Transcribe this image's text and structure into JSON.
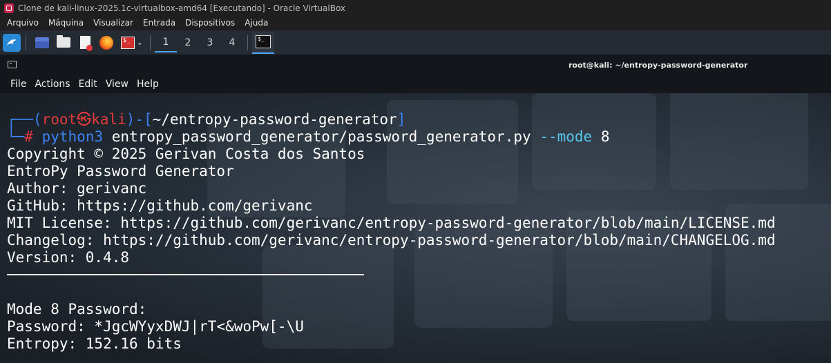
{
  "vbox": {
    "title": "Clone de kali-linux-2025.1c-virtualbox-amd64 [Executando] - Oracle VirtualBox",
    "menu": [
      "Arquivo",
      "Máquina",
      "Visualizar",
      "Entrada",
      "Dispositivos",
      "Ajuda"
    ]
  },
  "panel": {
    "workspaces": [
      "1",
      "2",
      "3",
      "4"
    ],
    "active_workspace": "1",
    "icons": [
      "kali-dragon-icon",
      "desktop-icon",
      "folder-icon",
      "text-editor-icon",
      "firefox-icon",
      "terminal-icon"
    ]
  },
  "terminal": {
    "title": "root@kali: ~/entropy-password-generator",
    "menu": [
      "File",
      "Actions",
      "Edit",
      "View",
      "Help"
    ],
    "prompt": {
      "user": "root",
      "host": "kali",
      "path": "~/entropy-password-generator",
      "command": "python3",
      "args": "entropy_password_generator/password_generator.py",
      "flag": "--mode",
      "flag_value": "8"
    },
    "output": [
      "Copyright © 2025 Gerivan Costa dos Santos",
      "EntroPy Password Generator",
      "Author: gerivanc",
      "GitHub: https://github.com/gerivanc",
      "MIT License: https://github.com/gerivanc/entropy-password-generator/blob/main/LICENSE.md",
      "Changelog: https://github.com/gerivanc/entropy-password-generator/blob/main/CHANGELOG.md",
      "Version: 0.4.8"
    ],
    "result": [
      "Mode 8 Password:",
      "Password: *JgcWYyxDWJ|rT<&woPw[-\\U",
      "Entropy: 152.16 bits"
    ]
  }
}
